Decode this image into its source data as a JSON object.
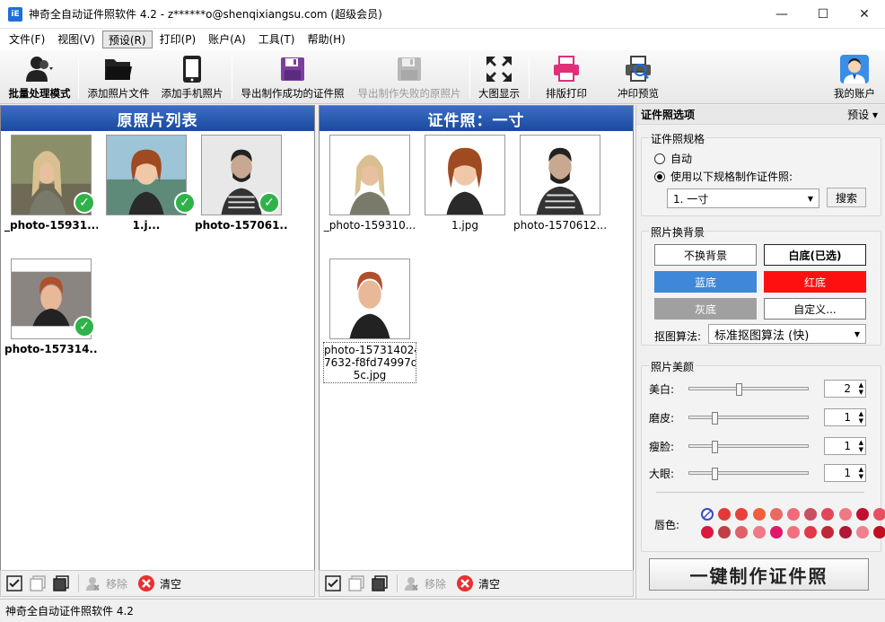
{
  "window": {
    "title": "神奇全自动证件照软件 4.2 - z******o@shenqixiangsu.com (超级会员)",
    "app_icon": "iE",
    "minimize": "—",
    "maximize": "☐",
    "close": "✕"
  },
  "menu": [
    "文件(F)",
    "视图(V)",
    "预设(R)",
    "打印(P)",
    "账户(A)",
    "工具(T)",
    "帮助(H)"
  ],
  "toolbar": {
    "batch": "批量处理模式",
    "add_photo": "添加照片文件",
    "add_phone": "添加手机照片",
    "export_ok": "导出制作成功的证件照",
    "export_fail": "导出制作失败的原照片",
    "big_view": "大图显示",
    "layout_print": "排版打印",
    "print_preview": "冲印预览",
    "my_account": "我的账户"
  },
  "left_panel": {
    "title": "原照片列表",
    "items": [
      {
        "caption": "_photo-15931..."
      },
      {
        "caption": "1.j..."
      },
      {
        "caption": "photo-157061..."
      },
      {
        "caption": "photo-157314..."
      }
    ]
  },
  "middle_panel": {
    "title": "证件照：一寸",
    "items": [
      {
        "caption": "_photo-159310..."
      },
      {
        "caption": "1.jpg"
      },
      {
        "caption": "photo-1570612..."
      },
      {
        "caption_lines": [
          "photo-157314024",
          "7632-f8fd74997d",
          "5c.jpg"
        ]
      }
    ]
  },
  "bottom_bar": {
    "remove": "移除",
    "clear": "清空"
  },
  "options": {
    "header": "证件照选项",
    "preset": "预设",
    "spec": {
      "title": "证件照规格",
      "auto": "自动",
      "use_spec": "使用以下规格制作证件照:",
      "selected": "1. 一寸",
      "search": "搜索"
    },
    "background": {
      "title": "照片换背景",
      "none": "不换背景",
      "white": "白底(已选)",
      "blue": "蓝底",
      "red": "红底",
      "gray": "灰底",
      "custom": "自定义...",
      "algo_label": "抠图算法:",
      "algo_value": "标准抠图算法 (快)",
      "colors": {
        "blue": "#3f87d8",
        "red": "#ff1010",
        "gray": "#a0a0a0"
      }
    },
    "beauty": {
      "title": "照片美颜",
      "rows": [
        {
          "label": "美白:",
          "value": "2",
          "level": 0.4
        },
        {
          "label": "磨皮:",
          "value": "1",
          "level": 0.2
        },
        {
          "label": "瘦脸:",
          "value": "1",
          "level": 0.2
        },
        {
          "label": "大眼:",
          "value": "1",
          "level": 0.2
        }
      ],
      "lip_label": "唇色:",
      "lip_colors_row1": [
        "none",
        "#e23a36",
        "#e8403a",
        "#f0603a",
        "#e86a60",
        "#f06a78",
        "#c85060",
        "#e04858",
        "#f07880",
        "#c01030",
        "#e85060"
      ],
      "lip_colors_row2": [
        "#d81840",
        "#c04048",
        "#e06068",
        "#f07888",
        "#e01868",
        "#f07080",
        "#e03848",
        "#c02838",
        "#b01838",
        "#f08090",
        "#c01020"
      ]
    },
    "make_button": "一键制作证件照"
  },
  "status": "神奇全自动证件照软件 4.2"
}
